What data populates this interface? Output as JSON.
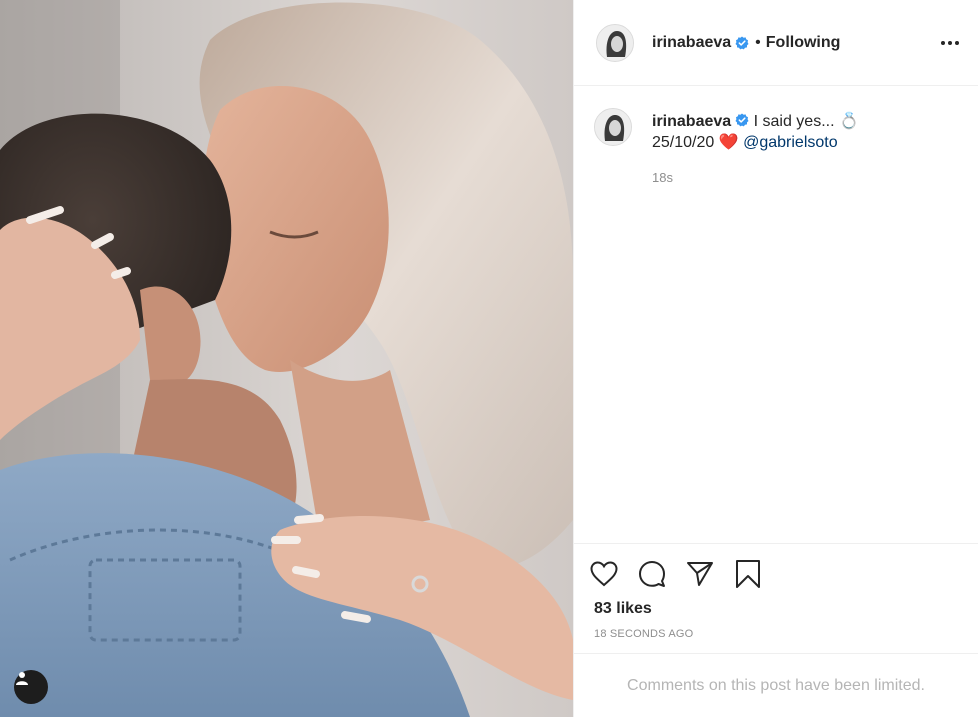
{
  "post": {
    "photo_alt": "",
    "user_tag_icon": "user-tag-icon"
  },
  "header": {
    "username": "irinabaeva",
    "verified_icon": "verified-badge-icon",
    "separator": "•",
    "follow_status": "Following",
    "more_icon": "more-options-icon"
  },
  "caption": {
    "username": "irinabaeva",
    "text_before": "I said yes... 💍",
    "date_text": "25/10/20",
    "heart_emoji": "❤️",
    "mention": "@gabrielsoto",
    "time_ago": "18s"
  },
  "actions": {
    "like_icon": "heart-icon",
    "comment_icon": "comment-icon",
    "share_icon": "share-icon",
    "save_icon": "bookmark-icon"
  },
  "stats": {
    "likes": "83 likes",
    "posted_ago": "18 SECONDS AGO"
  },
  "comments": {
    "limited_notice": "Comments on this post have been limited."
  },
  "colors": {
    "verified": "#3897f0",
    "mention": "#00376b",
    "muted": "#8e8e8e"
  }
}
